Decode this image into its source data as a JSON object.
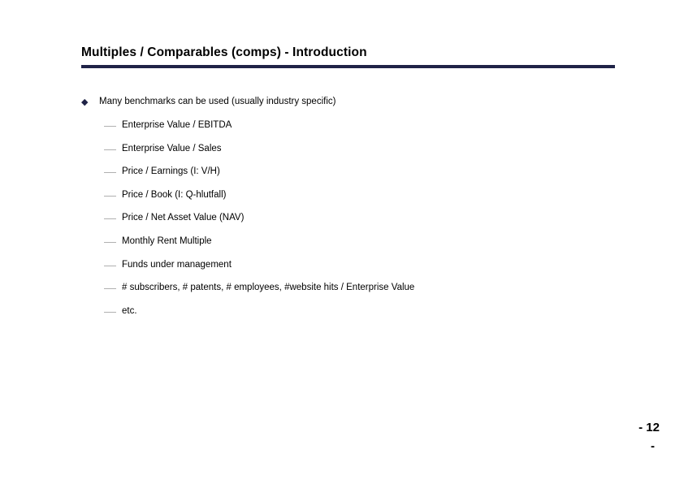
{
  "slide": {
    "title": "Multiples / Comparables (comps) - Introduction",
    "rule_color": "#1f2347",
    "background_color": "#ffffff"
  },
  "content": {
    "lead_bullet": {
      "marker": "diamond-bullet-icon",
      "marker_glyph": "◆",
      "marker_color": "#1f2347",
      "text": "Many benchmarks can be used (usually industry specific)"
    },
    "sub_items": [
      {
        "marker": "em-dash-icon",
        "text": "Enterprise Value / EBITDA"
      },
      {
        "marker": "em-dash-icon",
        "text": "Enterprise Value / Sales"
      },
      {
        "marker": "em-dash-icon",
        "text": "Price / Earnings (I: V/H)"
      },
      {
        "marker": "em-dash-icon",
        "text": "Price / Book (I: Q-hlutfall)"
      },
      {
        "marker": "em-dash-icon",
        "text": "Price / Net Asset Value (NAV)"
      },
      {
        "marker": "em-dash-icon",
        "text": "Monthly Rent Multiple"
      },
      {
        "marker": "em-dash-icon",
        "text": "Funds under management"
      },
      {
        "marker": "em-dash-icon",
        "text": "# subscribers, # patents, # employees, #website hits / Enterprise Value"
      },
      {
        "marker": "em-dash-icon",
        "text": "etc."
      }
    ]
  },
  "footer": {
    "page_number_line1": "- 12",
    "page_number_line2": "-"
  }
}
